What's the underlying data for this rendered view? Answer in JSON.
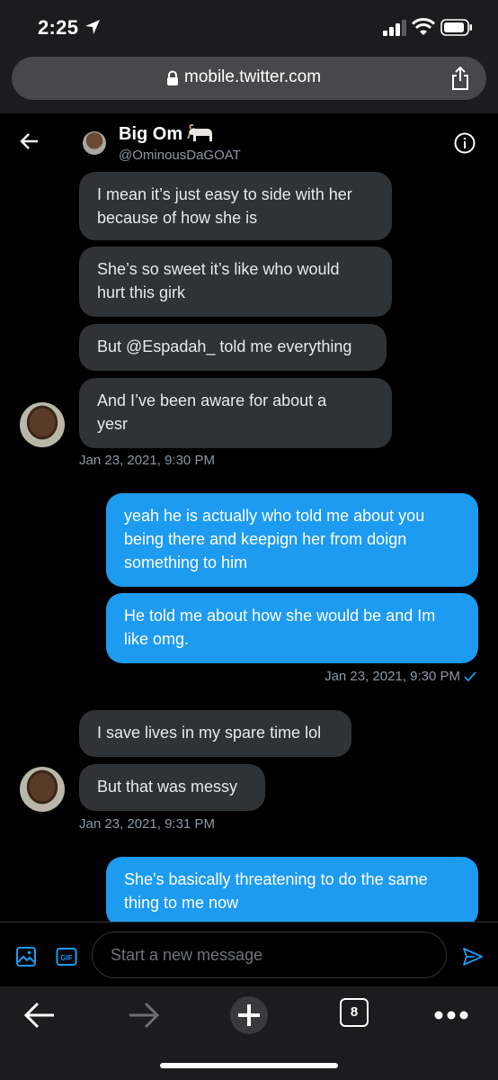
{
  "status": {
    "time": "2:25"
  },
  "browser": {
    "url": "mobile.twitter.com",
    "open_tabs": "8"
  },
  "conversation": {
    "name": "Big Om",
    "handle": "@OminousDaGOAT"
  },
  "messages": {
    "m1": "I mean it’s just easy to side with her\nbecause of how she is",
    "m2": "She’s so sweet it’s like who would\nhurt this girk",
    "m3": "But @Espadah_ told me everything",
    "m4": "And I’ve been aware for about a\nyesr",
    "t1": "Jan 23, 2021, 9:30 PM",
    "m5": "yeah he is actually who told me about you\nbeing there and keepign her from doign\nsomething to him",
    "m6": "He told me about how she would be and Im\nlike omg.",
    "t2": "Jan 23, 2021, 9:30 PM",
    "m7": "I save lives in my spare time lol",
    "m8": "But that was messy",
    "t3": "Jan 23, 2021, 9:31 PM",
    "m9": "She's basically threatening to do the same\nthing to me now"
  },
  "composer": {
    "placeholder": "Start a new message"
  },
  "colors": {
    "accent": "#1d9bf0",
    "incoming_bubble": "#2f3336",
    "background": "#000000"
  },
  "icons": [
    "location-arrow-icon",
    "signal-icon",
    "wifi-icon",
    "battery-icon",
    "lock-icon",
    "share-icon",
    "back-arrow-icon",
    "goat-emoji-icon",
    "info-icon",
    "read-check-icon",
    "image-icon",
    "gif-icon",
    "send-icon",
    "browser-back-icon",
    "browser-forward-icon",
    "new-tab-icon",
    "more-icon"
  ]
}
